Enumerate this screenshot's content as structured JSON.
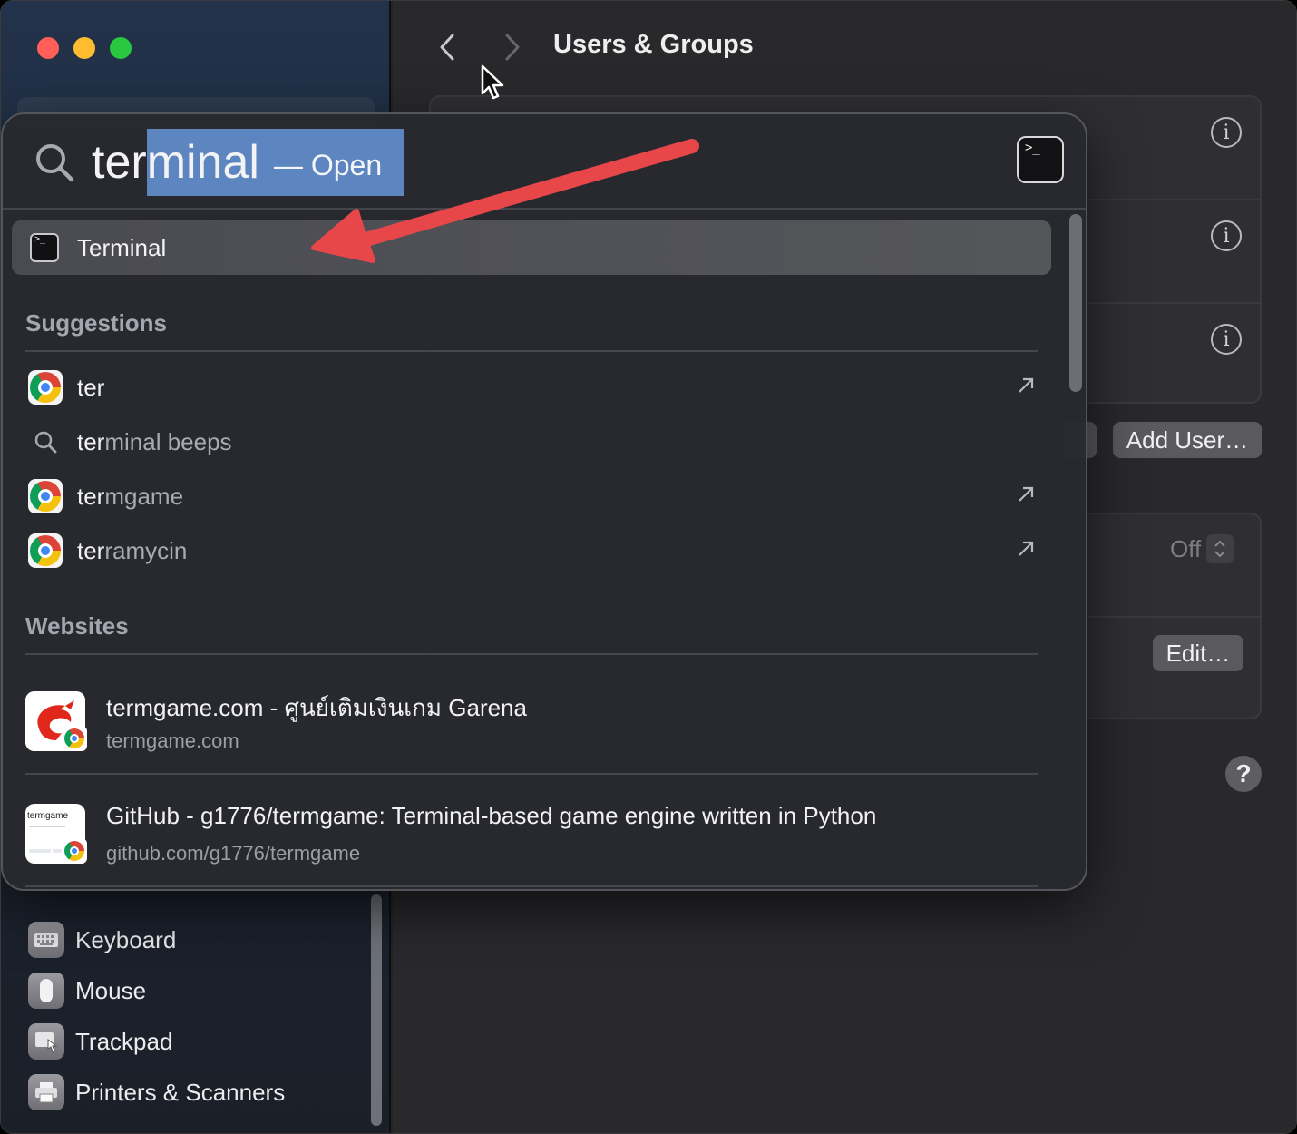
{
  "window": {
    "title": "Users & Groups"
  },
  "sidebar": {
    "items": [
      {
        "label": "Keyboard",
        "icon": "keyboard-icon"
      },
      {
        "label": "Mouse",
        "icon": "mouse-icon"
      },
      {
        "label": "Trackpad",
        "icon": "trackpad-icon"
      },
      {
        "label": "Printers & Scanners",
        "icon": "printer-icon"
      }
    ]
  },
  "main": {
    "title": "Users & Groups",
    "add_user_label": "Add User…",
    "off_label": "Off",
    "edit_label": "Edit…",
    "help_label": "?"
  },
  "spotlight": {
    "query_typed": "ter",
    "query_completion": "minal",
    "hint": "— Open",
    "top_hit": {
      "label": "Terminal",
      "icon": "terminal-icon"
    },
    "suggestions_title": "Suggestions",
    "suggestions": [
      {
        "typed": "ter",
        "rest": "",
        "icon": "chrome-icon",
        "action": "open-in-browser-arrow"
      },
      {
        "typed": "ter",
        "rest": "minal beeps",
        "icon": "search-icon",
        "action": ""
      },
      {
        "typed": "ter",
        "rest": "mgame",
        "icon": "chrome-icon",
        "action": "open-in-browser-arrow"
      },
      {
        "typed": "ter",
        "rest": "ramycin",
        "icon": "chrome-icon",
        "action": "open-in-browser-arrow"
      }
    ],
    "websites_title": "Websites",
    "websites": [
      {
        "title": "termgame.com - ศูนย์เติมเงินเกม Garena",
        "url": "termgame.com",
        "icon": "garena-icon"
      },
      {
        "title": "GitHub - g1776/termgame: Terminal-based game engine written in Python",
        "url": "github.com/g1776/termgame",
        "icon": "github-page-thumbnail",
        "thumb_text": "termgame"
      }
    ]
  },
  "colors": {
    "accent_selection": "#5d86c0",
    "annotation_arrow": "#e8474a",
    "close": "#ff5f57",
    "minimize": "#febc2e",
    "zoom": "#28c840"
  }
}
